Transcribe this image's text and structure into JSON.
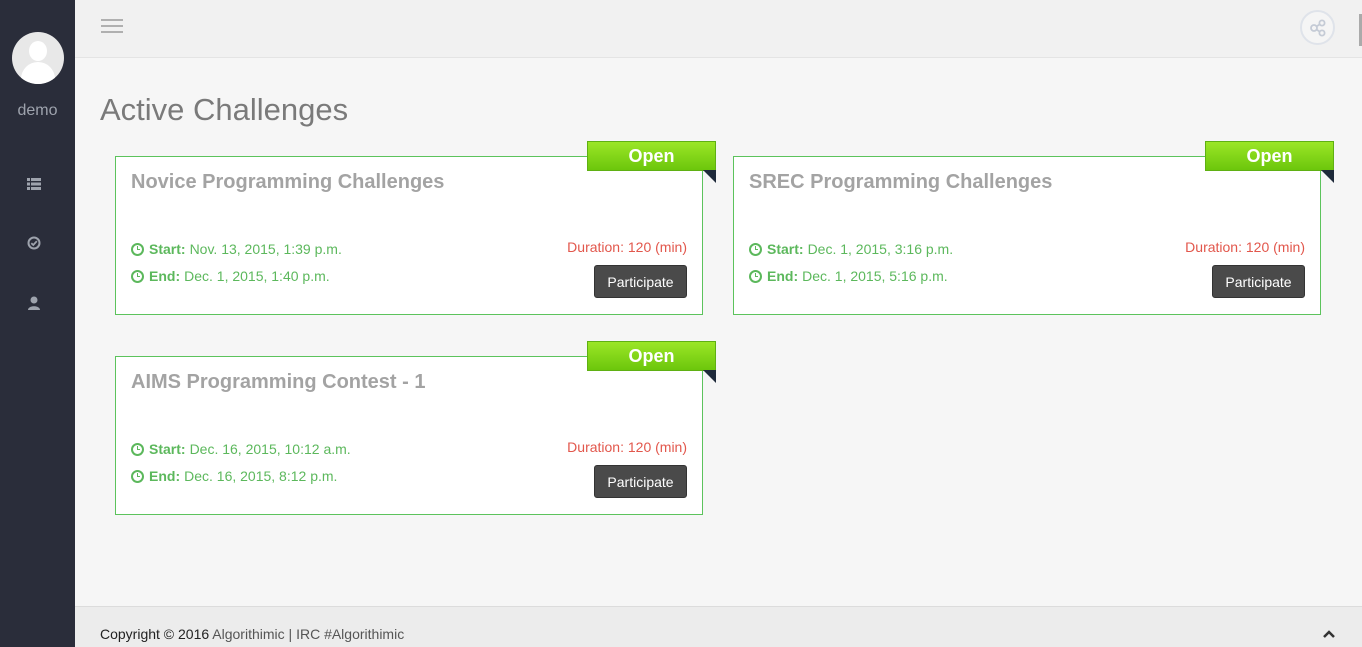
{
  "sidebar": {
    "username": "demo",
    "icons": [
      "list-icon",
      "check-circle-icon",
      "user-icon"
    ]
  },
  "header": {
    "menu_icon": "hamburger-icon",
    "share_icon": "share-icon"
  },
  "main": {
    "title": "Active Challenges",
    "challenges": [
      {
        "title": "Novice Programming Challenges",
        "status": "Open",
        "start_label": "Start:",
        "start": "Nov. 13, 2015, 1:39 p.m.",
        "end_label": "End:",
        "end": "Dec. 1, 2015, 1:40 p.m.",
        "duration": "Duration: 120 (min)",
        "action": "Participate"
      },
      {
        "title": "SREC Programming Challenges",
        "status": "Open",
        "start_label": "Start:",
        "start": "Dec. 1, 2015, 3:16 p.m.",
        "end_label": "End:",
        "end": "Dec. 1, 2015, 5:16 p.m.",
        "duration": "Duration: 120 (min)",
        "action": "Participate"
      },
      {
        "title": "AIMS Programming Contest - 1",
        "status": "Open",
        "start_label": "Start:",
        "start": "Dec. 16, 2015, 10:12 a.m.",
        "end_label": "End:",
        "end": "Dec. 16, 2015, 8:12 p.m.",
        "duration": "Duration: 120 (min)",
        "action": "Participate"
      }
    ]
  },
  "footer": {
    "copyright": "Copyright © 2016",
    "brand": "Algorithimic",
    "separator": "|",
    "irc": "IRC #Algorithimic",
    "scroll_top_icon": "chevron-up-icon"
  },
  "colors": {
    "sidebar": "#2a2d3a",
    "open_badge": "#7fd41a",
    "card_border": "#5cc35c",
    "duration": "#e2574c",
    "button": "#4a4a4a"
  }
}
